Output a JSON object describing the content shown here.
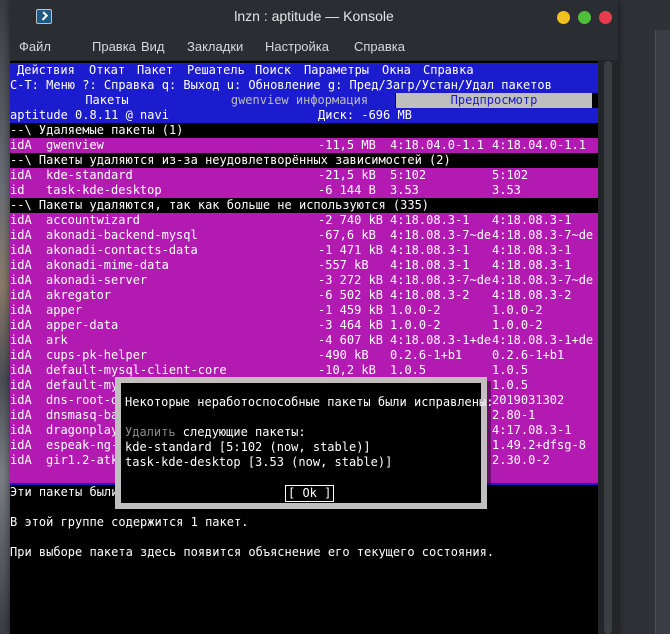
{
  "window": {
    "title": "lnzn : aptitude — Konsole"
  },
  "menubar": [
    "Файл",
    "Правка",
    "Вид",
    "Закладки",
    "Настройка",
    "Справка"
  ],
  "aptitude": {
    "menu": [
      "Действия",
      "Откат",
      "Пакет",
      "Решатель",
      "Поиск",
      "Параметры",
      "Окна",
      "Справка"
    ],
    "hints": "C-T: Меню ?: Справка q: Выход u: Обновление g: Пред/Загр/Устан/Удал пакетов",
    "tabs": [
      "Пакеты",
      "gwenview информация",
      "Предпросмотр"
    ],
    "status_left": "aptitude 0.8.11 @ navi",
    "status_right": "Диск: -696 MB",
    "groups": [
      {
        "header": "--\\ Удаляемые пакеты (1)",
        "rows": [
          {
            "flags": "idA",
            "name": "gwenview",
            "size": "-11,5 MB",
            "cur": "4:18.04.0-1.1",
            "new": "4:18.04.0-1.1"
          }
        ]
      },
      {
        "header": "--\\ Пакеты удаляются из-за неудовлетворённых зависимостей (2)",
        "rows": [
          {
            "flags": "idA",
            "name": "kde-standard",
            "size": "-21,5 kB",
            "cur": "5:102",
            "new": "5:102"
          },
          {
            "flags": "id",
            "name": "task-kde-desktop",
            "size": "-6 144 B",
            "cur": "3.53",
            "new": "3.53"
          }
        ]
      },
      {
        "header": "--\\ Пакеты удаляются, так как больше не используются (335)",
        "rows": [
          {
            "flags": "idA",
            "name": "accountwizard",
            "size": "-2 740 kB",
            "cur": "4:18.08.3-1",
            "new": "4:18.08.3-1"
          },
          {
            "flags": "idA",
            "name": "akonadi-backend-mysql",
            "size": "-67,6 kB",
            "cur": "4:18.08.3-7~de",
            "new": "4:18.08.3-7~de"
          },
          {
            "flags": "idA",
            "name": "akonadi-contacts-data",
            "size": "-1 471 kB",
            "cur": "4:18.08.3-1",
            "new": "4:18.08.3-1"
          },
          {
            "flags": "idA",
            "name": "akonadi-mime-data",
            "size": "-557 kB",
            "cur": "4:18.08.3-1",
            "new": "4:18.08.3-1"
          },
          {
            "flags": "idA",
            "name": "akonadi-server",
            "size": "-3 272 kB",
            "cur": "4:18.08.3-7~de",
            "new": "4:18.08.3-7~de"
          },
          {
            "flags": "idA",
            "name": "akregator",
            "size": "-6 502 kB",
            "cur": "4:18.08.3-2",
            "new": "4:18.08.3-2"
          },
          {
            "flags": "idA",
            "name": "apper",
            "size": "-1 459 kB",
            "cur": "1.0.0-2",
            "new": "1.0.0-2"
          },
          {
            "flags": "idA",
            "name": "apper-data",
            "size": "-3 464 kB",
            "cur": "1.0.0-2",
            "new": "1.0.0-2"
          },
          {
            "flags": "idA",
            "name": "ark",
            "size": "-4 607 kB",
            "cur": "4:18.08.3-1+de",
            "new": "4:18.08.3-1+de"
          },
          {
            "flags": "idA",
            "name": "cups-pk-helper",
            "size": "-490 kB",
            "cur": "0.2.6-1+b1",
            "new": "0.2.6-1+b1"
          },
          {
            "flags": "idA",
            "name": "default-mysql-client-core",
            "size": "-10,2 kB",
            "cur": "1.0.5",
            "new": "1.0.5"
          },
          {
            "flags": "idA",
            "name": "default-my",
            "size": "",
            "cur": "",
            "new": "1.0.5"
          },
          {
            "flags": "idA",
            "name": "dns-root-d",
            "size": "",
            "cur": "",
            "new": "2019031302"
          },
          {
            "flags": "idA",
            "name": "dnsmasq-ba",
            "size": "",
            "cur": "",
            "new": "2.80-1"
          },
          {
            "flags": "idA",
            "name": "dragonplay",
            "size": "",
            "cur": "",
            "new": "4:17.08.3-1"
          },
          {
            "flags": "idA",
            "name": "espeak-ng-",
            "size": "",
            "cur": "",
            "new": "1.49.2+dfsg-8"
          },
          {
            "flags": "idA",
            "name": "gir1.2-atk",
            "size": "",
            "cur": "",
            "new": "2.30.0-2"
          }
        ]
      }
    ],
    "info_lines": [
      "Эти пакеты были",
      "",
      "В этой группе содержится 1 пакет.",
      "",
      "При выборе пакета здесь появится объяснение его текущего состояния."
    ],
    "dialog": {
      "title": "Некоторые неработоспособные пакеты были исправлены:",
      "action_word": "Удалить",
      "action_rest": " следующие пакеты:",
      "items": [
        "kde-standard [5:102 (now, stable)]",
        "task-kde-desktop [3.53 (now, stable)]"
      ],
      "ok_label": "[ Ok ]"
    }
  }
}
